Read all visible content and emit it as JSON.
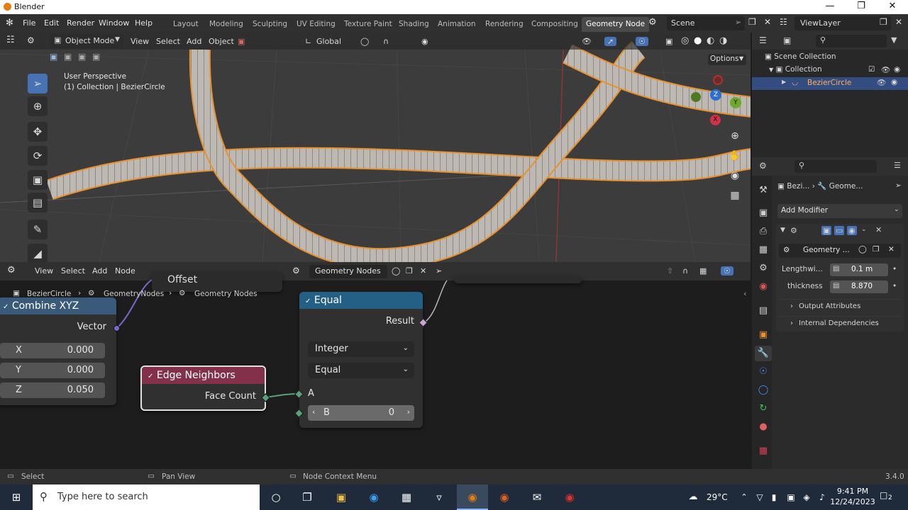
{
  "window": {
    "title": "Blender"
  },
  "menus": [
    "File",
    "Edit",
    "Render",
    "Window",
    "Help"
  ],
  "workspaces": [
    "Layout",
    "Modeling",
    "Sculpting",
    "UV Editing",
    "Texture Paint",
    "Shading",
    "Animation",
    "Rendering",
    "Compositing",
    "Geometry Node"
  ],
  "active_workspace": "Geometry Node",
  "scene": {
    "name": "Scene",
    "view_layer": "ViewLayer"
  },
  "viewport": {
    "mode": "Object Mode",
    "menu": [
      "View",
      "Select",
      "Add",
      "Object"
    ],
    "transform": "Global",
    "options_label": "Options",
    "info_line1": "User Perspective",
    "info_line2": "(1) Collection | BezierCircle",
    "gizmo": {
      "x": "X",
      "y": "Y",
      "z": "Z"
    }
  },
  "node_editor": {
    "menu": [
      "View",
      "Select",
      "Add",
      "Node"
    ],
    "tree_name": "Geometry Nodes",
    "breadcrumb": [
      "BezierCircle",
      "GeometryNodes",
      "Geometry Nodes"
    ],
    "offset_label": "Offset",
    "nodes": {
      "combine_xyz": {
        "title": "Combine XYZ",
        "output": "Vector",
        "x_label": "X",
        "x_value": "0.000",
        "y_label": "Y",
        "y_value": "0.000",
        "z_label": "Z",
        "z_value": "0.050"
      },
      "edge_neighbors": {
        "title": "Edge Neighbors",
        "output": "Face Count"
      },
      "equal": {
        "title": "Equal",
        "output": "Result",
        "data_type": "Integer",
        "mode": "Equal",
        "input_a": "A",
        "input_b": "B",
        "b_value": "0"
      }
    }
  },
  "outliner": {
    "root": "Scene Collection",
    "collection": "Collection",
    "object": "BezierCircle"
  },
  "properties": {
    "breadcrumb_obj": "Bezi...",
    "breadcrumb_mod": "Geome...",
    "add_modifier": "Add Modifier",
    "modifier_name": "Geometry ...",
    "params": [
      {
        "label": "Lengthwi...",
        "value": "0.1 m"
      },
      {
        "label": "thickness",
        "value": "8.870"
      }
    ],
    "panels": [
      "Output Attributes",
      "Internal Dependencies"
    ]
  },
  "status": {
    "left": "Select",
    "middle": "Pan View",
    "right": "Node Context Menu",
    "version": "3.4.0"
  },
  "taskbar": {
    "search_placeholder": "Type here to search",
    "weather": "29°C",
    "time": "9:41 PM",
    "date": "12/24/2023",
    "notifications": "2"
  },
  "colors": {
    "accent": "#4772b3",
    "node_header_vector": "#3a5a7a",
    "node_header_input": "#83314a",
    "node_header_function": "#245f85",
    "curve_fill": "#b8b4af",
    "curve_outline": "#e8912e"
  }
}
